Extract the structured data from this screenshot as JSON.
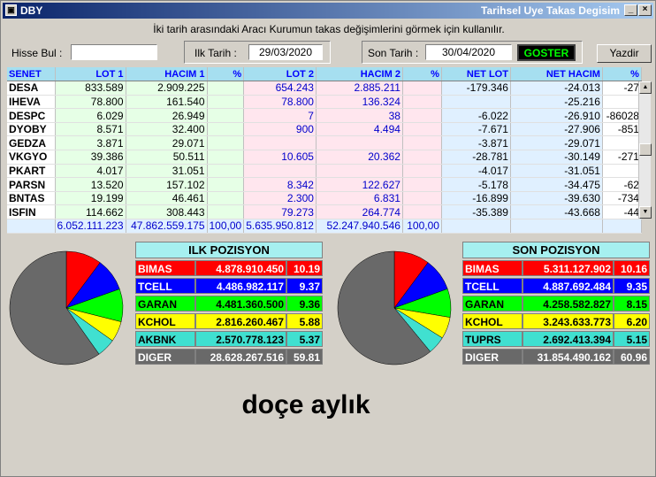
{
  "window": {
    "title": "DBY",
    "subtitle": "Tarihsel Uye Takas Degisim"
  },
  "info_text": "İki tarih arasındaki  Aracı Kurumun takas değişimlerini görmek için kullanılır.",
  "filters": {
    "hisse_label": "Hisse Bul :",
    "hisse_value": "",
    "ilk_label": "Ilk Tarih :",
    "ilk_value": "29/03/2020",
    "son_label": "Son Tarih :",
    "son_value": "30/04/2020",
    "goster_label": "GOSTER",
    "yazdir_label": "Yazdir"
  },
  "table": {
    "headers": [
      "SENET",
      "LOT 1",
      "HACIM 1",
      "%",
      "LOT 2",
      "HACIM 2",
      "%",
      "NET LOT",
      "NET HACIM",
      "%"
    ],
    "rows": [
      [
        "DESA",
        "833.589",
        "2.909.225",
        "",
        "654.243",
        "2.885.211",
        "",
        "-179.346",
        "-24.013",
        "-27"
      ],
      [
        "IHEVA",
        "78.800",
        "161.540",
        "",
        "78.800",
        "136.324",
        "",
        "",
        "-25.216",
        ""
      ],
      [
        "DESPC",
        "6.029",
        "26.949",
        "",
        "7",
        "38",
        "",
        "-6.022",
        "-26.910",
        "-86028"
      ],
      [
        "DYOBY",
        "8.571",
        "32.400",
        "",
        "900",
        "4.494",
        "",
        "-7.671",
        "-27.906",
        "-851"
      ],
      [
        "GEDZA",
        "3.871",
        "29.071",
        "",
        "",
        "",
        "",
        "-3.871",
        "-29.071",
        ""
      ],
      [
        "VKGYO",
        "39.386",
        "50.511",
        "",
        "10.605",
        "20.362",
        "",
        "-28.781",
        "-30.149",
        "-271"
      ],
      [
        "PKART",
        "4.017",
        "31.051",
        "",
        "",
        "",
        "",
        "-4.017",
        "-31.051",
        ""
      ],
      [
        "PARSN",
        "13.520",
        "157.102",
        "",
        "8.342",
        "122.627",
        "",
        "-5.178",
        "-34.475",
        "-62"
      ],
      [
        "BNTAS",
        "19.199",
        "46.461",
        "",
        "2.300",
        "6.831",
        "",
        "-16.899",
        "-39.630",
        "-734"
      ],
      [
        "ISFIN",
        "114.662",
        "308.443",
        "",
        "79.273",
        "264.774",
        "",
        "-35.389",
        "-43.668",
        "-44"
      ]
    ],
    "totals": [
      "",
      "6.052.111.223",
      "47.862.559.175",
      "100,00",
      "5.635.950.812",
      "52.247.940.546",
      "100,00",
      "",
      "",
      ""
    ]
  },
  "ilk_pozisyon": {
    "title": "ILK POZISYON",
    "rows": [
      {
        "name": "BIMAS",
        "value": "4.878.910.450",
        "pct": "10.19",
        "color": "#ff0000",
        "text": "#ffffff",
        "share": 10.19
      },
      {
        "name": "TCELL",
        "value": "4.486.982.117",
        "pct": "9.37",
        "color": "#0000ff",
        "text": "#ffffff",
        "share": 9.37
      },
      {
        "name": "GARAN",
        "value": "4.481.360.500",
        "pct": "9.36",
        "color": "#00ff00",
        "text": "#000000",
        "share": 9.36
      },
      {
        "name": "KCHOL",
        "value": "2.816.260.467",
        "pct": "5.88",
        "color": "#ffff00",
        "text": "#000000",
        "share": 5.88
      },
      {
        "name": "AKBNK",
        "value": "2.570.778.123",
        "pct": "5.37",
        "color": "#40e0d0",
        "text": "#000000",
        "share": 5.37
      },
      {
        "name": "DIGER",
        "value": "28.628.267.516",
        "pct": "59.81",
        "color": "#696969",
        "text": "#ffffff",
        "share": 59.81
      }
    ]
  },
  "son_pozisyon": {
    "title": "SON POZISYON",
    "rows": [
      {
        "name": "BIMAS",
        "value": "5.311.127.902",
        "pct": "10.16",
        "color": "#ff0000",
        "text": "#ffffff",
        "share": 10.16
      },
      {
        "name": "TCELL",
        "value": "4.887.692.484",
        "pct": "9.35",
        "color": "#0000ff",
        "text": "#ffffff",
        "share": 9.35
      },
      {
        "name": "GARAN",
        "value": "4.258.582.827",
        "pct": "8.15",
        "color": "#00ff00",
        "text": "#000000",
        "share": 8.15
      },
      {
        "name": "KCHOL",
        "value": "3.243.633.773",
        "pct": "6.20",
        "color": "#ffff00",
        "text": "#000000",
        "share": 6.2
      },
      {
        "name": "TUPRS",
        "value": "2.692.413.394",
        "pct": "5.15",
        "color": "#40e0d0",
        "text": "#000000",
        "share": 5.15
      },
      {
        "name": "DIGER",
        "value": "31.854.490.162",
        "pct": "60.96",
        "color": "#696969",
        "text": "#ffffff",
        "share": 60.96
      }
    ]
  },
  "footer_text": "doçe aylık"
}
